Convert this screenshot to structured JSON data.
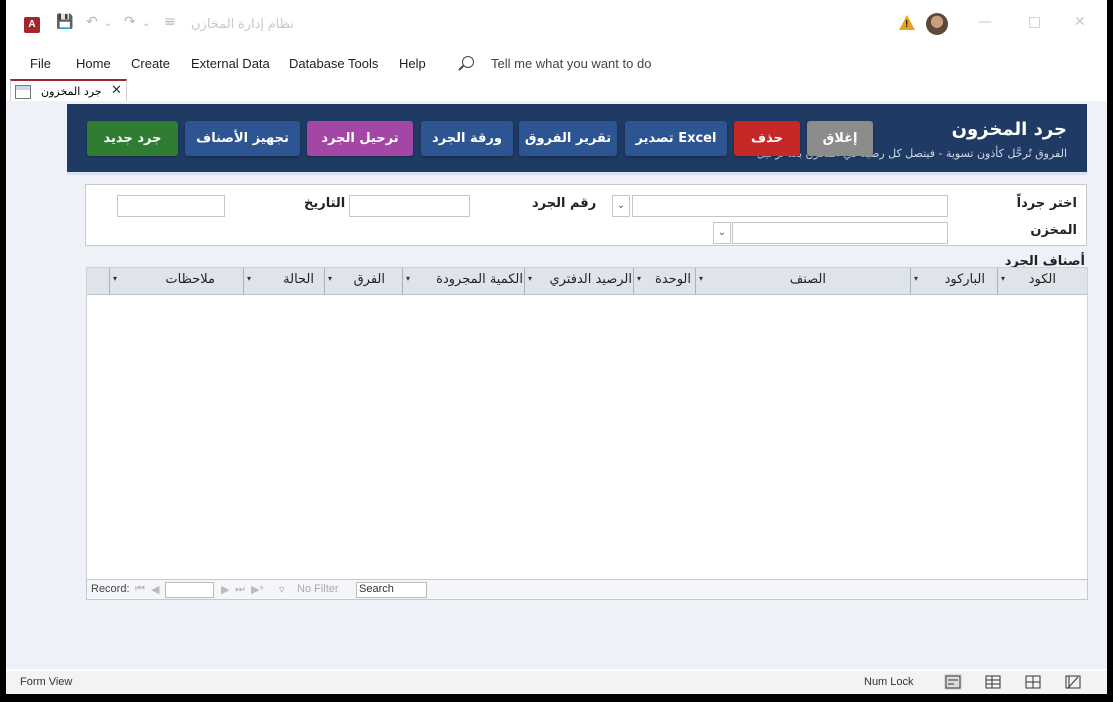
{
  "window": {
    "app_icon_letter": "A",
    "doc_title": "نظام إدارة المخازن",
    "quick_access": [
      "save-icon",
      "undo-icon",
      "redo-icon",
      "customize-icon"
    ],
    "controls": [
      "minimize-icon",
      "maximize-icon",
      "close-icon"
    ]
  },
  "ribbon": {
    "tabs": [
      "File",
      "Home",
      "Create",
      "External Data",
      "Database Tools",
      "Help"
    ],
    "tell_me": "Tell me what you want to do"
  },
  "doc_tab": {
    "label": "جرد المخزون"
  },
  "form": {
    "title": "جرد المخزون",
    "subtitle": "الفروق تُرحَّل كأذون تسوية - فيتصل كل رصيد في المخزن بعد ترحيل",
    "buttons": {
      "close": "إغلاق",
      "delete": "حذف",
      "export": "تصدير Excel",
      "diff_report": "تقرير الفروق",
      "sheet": "ورقة الجرد",
      "post": "ترحيل الجرد",
      "prepare": "تجهيز الأصناف",
      "new": "جرد جديد"
    },
    "filters": {
      "choose_label": "اختر جرداً",
      "number_label": "رقم الجرد",
      "date_label": "التاريخ",
      "warehouse_label": "المخزن",
      "choose_value": "",
      "number_value": "",
      "date_value": "",
      "warehouse_value": ""
    },
    "section_label": "أصناف الجرد",
    "columns": [
      "الكود",
      "الباركود",
      "الصنف",
      "الوحدة",
      "الرصيد الدفتري",
      "الكمية المجرودة",
      "الفرق",
      "الحالة",
      "ملاحظات"
    ],
    "rows": []
  },
  "record_nav": {
    "record_label": "Record:",
    "nav_icons": [
      "first-record-icon",
      "prev-record-icon",
      "next-record-icon",
      "last-record-icon",
      "new-record-icon"
    ],
    "filter_label": "No Filter",
    "search_label": "Search"
  },
  "status": {
    "view": "Form View",
    "num_lock": "Num Lock"
  },
  "colors": {
    "header_bg": "#1f3b63",
    "close_btn": "#8c8c8c",
    "delete_btn": "#c62828",
    "blue_btn": "#2c5592",
    "post_btn": "#a446a6",
    "new_btn": "#2e7d32"
  }
}
